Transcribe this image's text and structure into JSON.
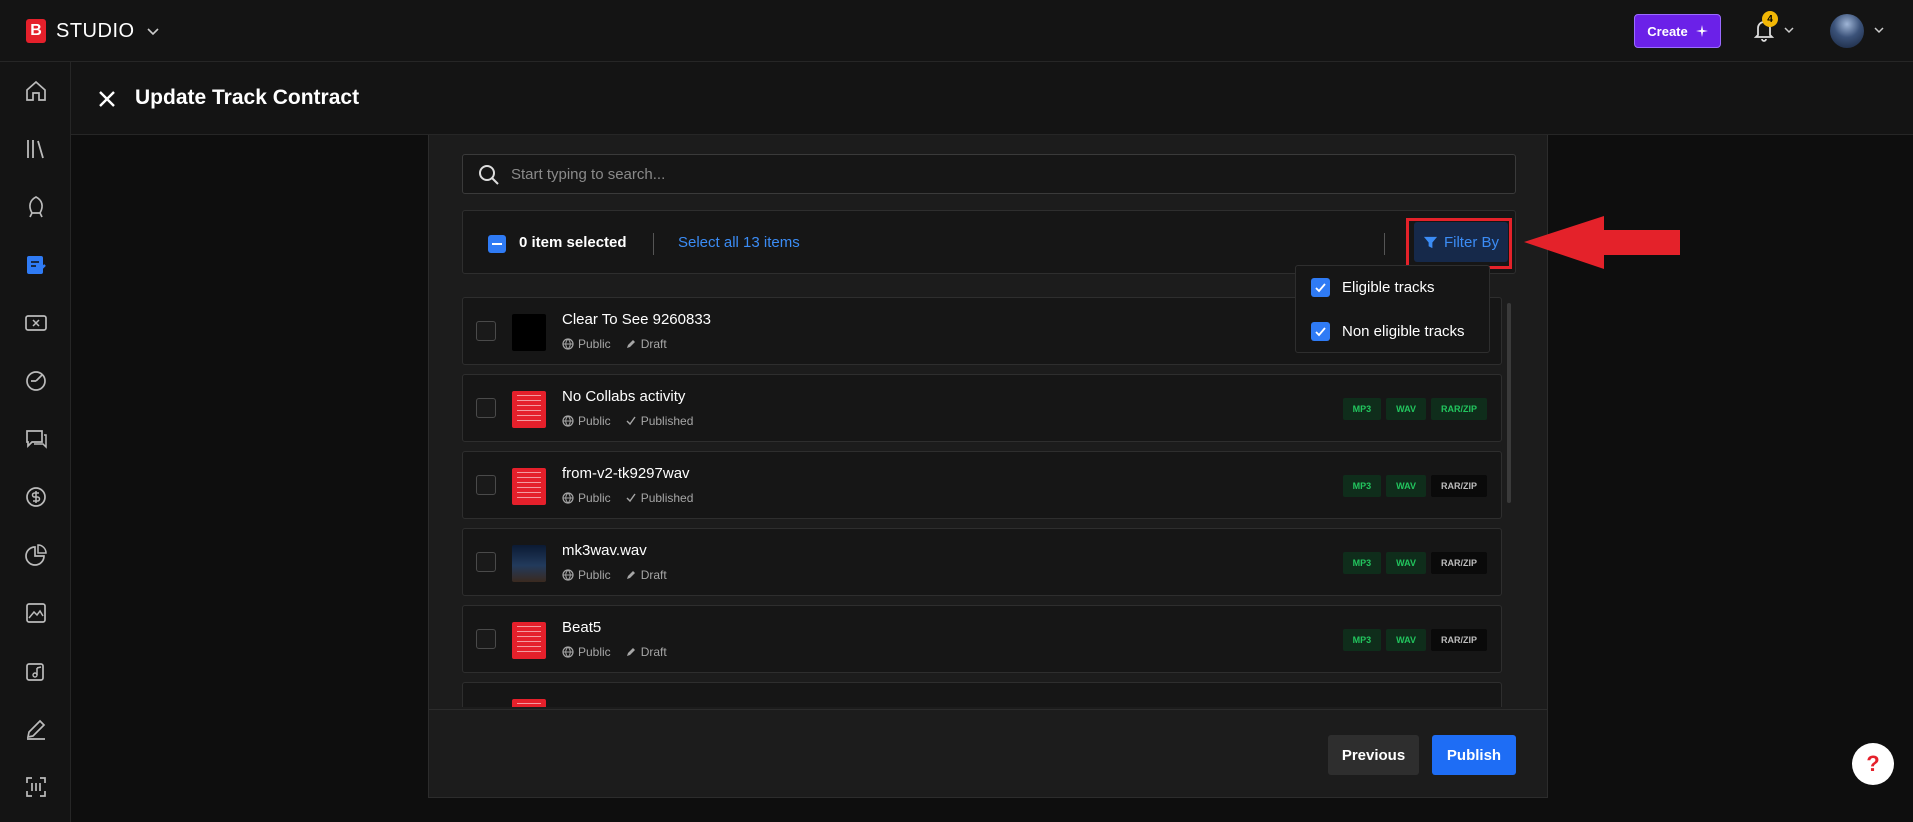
{
  "header": {
    "logo_text": "STUDIO",
    "create_label": "Create",
    "notification_count": "4"
  },
  "sidebar": {
    "items": [
      {
        "icon": "home-icon"
      },
      {
        "icon": "library-icon"
      },
      {
        "icon": "promote-icon"
      },
      {
        "icon": "contracts-icon",
        "active": true
      },
      {
        "icon": "coupon-icon"
      },
      {
        "icon": "analytics-icon"
      },
      {
        "icon": "messages-icon"
      },
      {
        "icon": "sales-icon"
      },
      {
        "icon": "reports-icon"
      },
      {
        "icon": "gallery-icon"
      },
      {
        "icon": "music-icon"
      },
      {
        "icon": "edit-icon"
      },
      {
        "icon": "scan-icon"
      }
    ]
  },
  "page": {
    "title": "Update Track Contract"
  },
  "search": {
    "placeholder": "Start typing to search..."
  },
  "selection": {
    "count_label": "0 item selected",
    "select_all_label": "Select all 13 items",
    "filter_label": "Filter By"
  },
  "filter_menu": {
    "options": [
      {
        "label": "Eligible tracks",
        "checked": true
      },
      {
        "label": "Non eligible tracks",
        "checked": true
      }
    ]
  },
  "tracks": [
    {
      "title": "Clear To See 9260833",
      "visibility": "Public",
      "status": "Draft",
      "thumb": "black",
      "tags": []
    },
    {
      "title": "No Collabs activity",
      "visibility": "Public",
      "status": "Published",
      "thumb": "red",
      "tags": [
        {
          "label": "MP3",
          "on": true
        },
        {
          "label": "WAV",
          "on": true
        },
        {
          "label": "RAR/ZIP",
          "on": true
        }
      ]
    },
    {
      "title": "from-v2-tk9297wav",
      "visibility": "Public",
      "status": "Published",
      "thumb": "red",
      "tags": [
        {
          "label": "MP3",
          "on": true
        },
        {
          "label": "WAV",
          "on": true
        },
        {
          "label": "RAR/ZIP",
          "on": false
        }
      ]
    },
    {
      "title": "mk3wav.wav",
      "visibility": "Public",
      "status": "Draft",
      "thumb": "night",
      "tags": [
        {
          "label": "MP3",
          "on": true
        },
        {
          "label": "WAV",
          "on": true
        },
        {
          "label": "RAR/ZIP",
          "on": false
        }
      ]
    },
    {
      "title": "Beat5",
      "visibility": "Public",
      "status": "Draft",
      "thumb": "red",
      "tags": [
        {
          "label": "MP3",
          "on": true
        },
        {
          "label": "WAV",
          "on": true
        },
        {
          "label": "RAR/ZIP",
          "on": false
        }
      ]
    }
  ],
  "footer": {
    "previous_label": "Previous",
    "publish_label": "Publish"
  },
  "help_label": "?",
  "colors": {
    "accent": "#1e6df5",
    "brand": "#e5202b",
    "create": "#6b21e8",
    "tag_on": "#22c55e"
  }
}
